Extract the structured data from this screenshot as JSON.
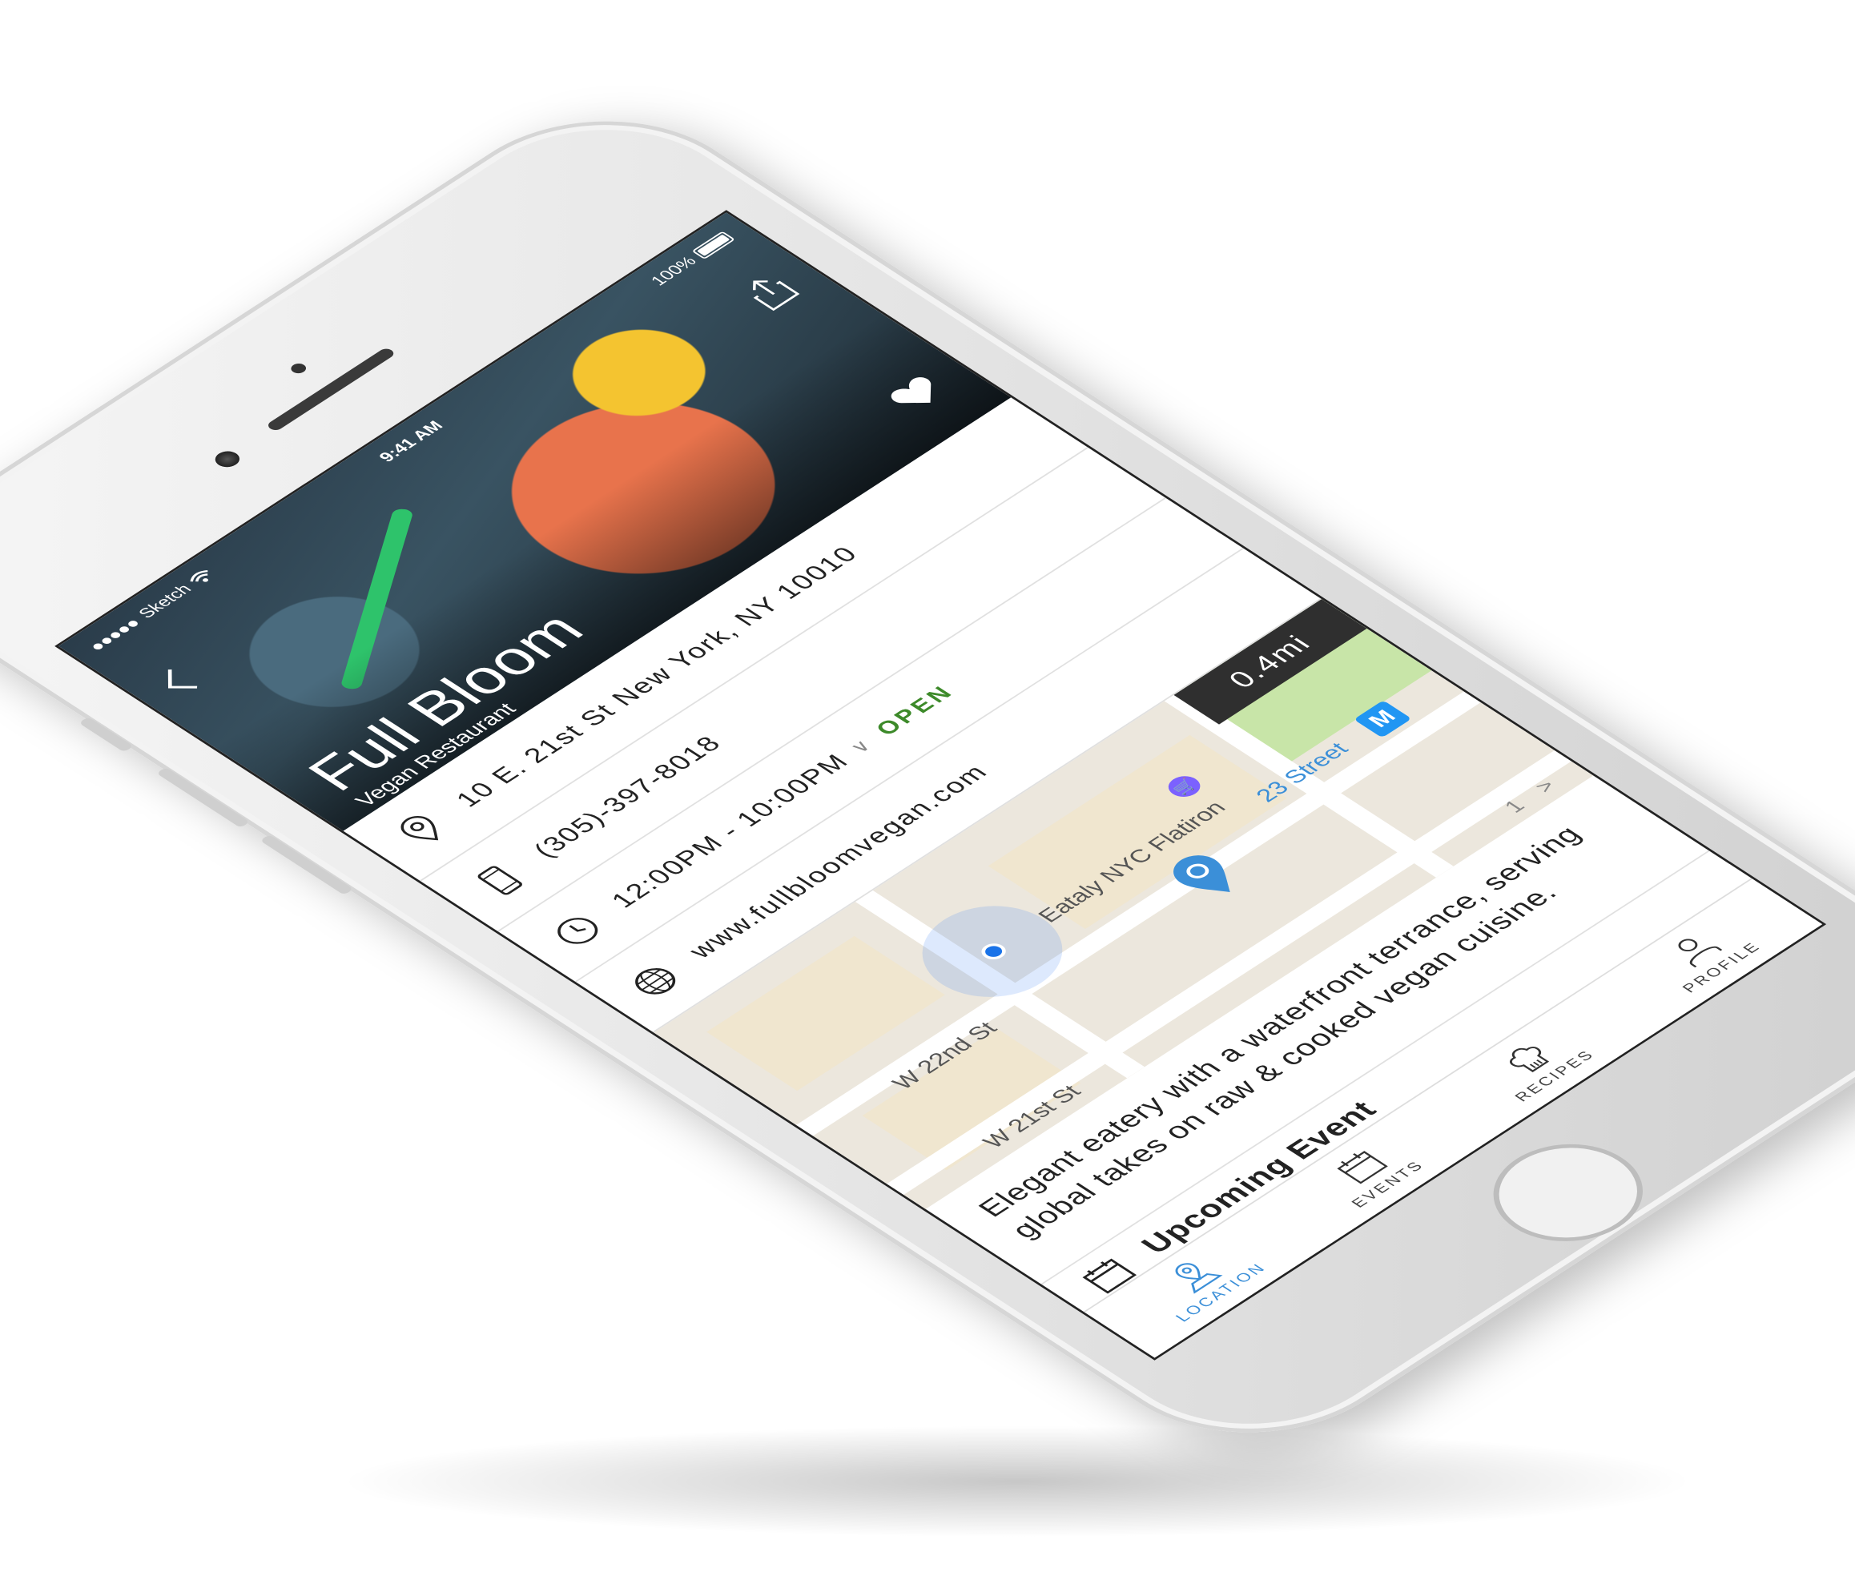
{
  "status_bar": {
    "carrier": "Sketch",
    "time": "9:41 AM",
    "battery": "100%",
    "battery_level": 1.0
  },
  "header": {
    "back_icon": "chevron-left-icon",
    "share_icon": "share-icon",
    "favorite_icon": "heart-icon",
    "title": "Full Bloom",
    "subtitle": "Vegan Restaurant"
  },
  "info": {
    "address": "10 E. 21st St New York, NY 10010",
    "phone": "(305)-397-8018",
    "hours": "12:00PM - 10:00PM",
    "hours_chevron": "∨",
    "status": "OPEN",
    "website": "www.fullbloomvegan.com"
  },
  "map": {
    "distance": "0.4mi",
    "place": "Eataly NYC Flatiron",
    "transit_label": "23 Street",
    "metro_badge": "M",
    "street_1": "W 22nd St",
    "street_2": "W 21st St"
  },
  "description": "Elegant eatery with a waterfront terrance, serving global takes on raw & cooked vegan cuisine.",
  "pager": {
    "page": "1",
    "next": ">"
  },
  "event": {
    "title": "Upcoming Event"
  },
  "tabs": [
    {
      "label": "LOCATION",
      "icon": "location-icon",
      "active": true
    },
    {
      "label": "EVENTS",
      "icon": "calendar-icon",
      "active": false
    },
    {
      "label": "RECIPES",
      "icon": "chef-hat-icon",
      "active": false
    },
    {
      "label": "PROFILE",
      "icon": "profile-icon",
      "active": false
    }
  ],
  "colors": {
    "open": "#3d8a2a",
    "active_tab": "#3b8fd8",
    "map_pin": "#3b8fd8",
    "distance_badge": "#2f2f2f"
  }
}
